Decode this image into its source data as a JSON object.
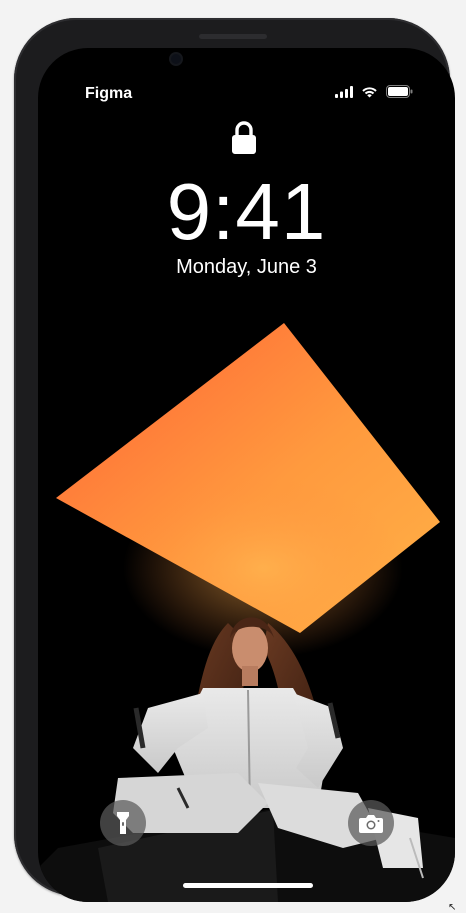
{
  "status_bar": {
    "carrier": "Figma",
    "icons": [
      "signal-icon",
      "wifi-icon",
      "battery-icon"
    ]
  },
  "lock_screen": {
    "lock_icon": "lock-icon",
    "time": "9:41",
    "date": "Monday, June 3"
  },
  "wallpaper": {
    "description_colors": {
      "background": "#000000",
      "shape_gradient": [
        "#ff6f3c",
        "#ffa83e"
      ]
    }
  },
  "quick_actions": {
    "left": "flashlight-icon",
    "right": "camera-icon"
  },
  "colors": {
    "frame": "#1c1c1e",
    "text": "#ffffff",
    "button_bg": "#5a5a5a"
  }
}
